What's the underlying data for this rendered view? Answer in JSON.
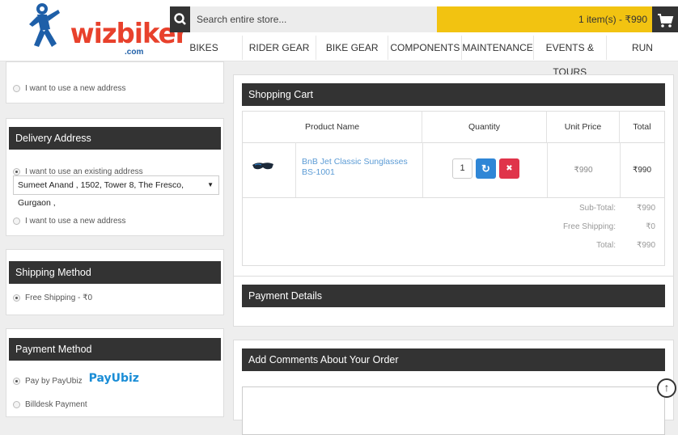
{
  "header": {
    "logo_text": "wizbiker",
    "logo_domain": ".com",
    "search_placeholder": "Search entire store...",
    "cart_label": "1 item(s) - ₹990",
    "nav": [
      "BIKES",
      "RIDER GEAR",
      "BIKE GEAR",
      "COMPONENTS",
      "MAINTENANCE",
      "EVENTS & TOURS",
      "RUN"
    ]
  },
  "payment_address": {
    "new_address_label": "I want to use a new address"
  },
  "delivery_address": {
    "title": "Delivery Address",
    "existing_label": "I want to use an existing address",
    "selected_address": "Sumeet Anand , 1502, Tower 8, The Fresco, Gurgaon ,",
    "new_address_label": "I want to use a new address"
  },
  "shipping_method": {
    "title": "Shipping Method",
    "option": "Free Shipping - ₹0"
  },
  "payment_method": {
    "title": "Payment Method",
    "option_payubiz": "Pay by PayUbiz",
    "payubiz_logo": "PayUbiz",
    "option_billdesk": "Billdesk Payment"
  },
  "cart": {
    "title": "Shopping Cart",
    "columns": [
      "Product Name",
      "Quantity",
      "Unit Price",
      "Total"
    ],
    "item": {
      "name": "BnB Jet Classic Sunglasses BS-1001",
      "quantity": "1",
      "unit_price": "₹990",
      "total": "₹990"
    },
    "totals": [
      {
        "label": "Sub-Total:",
        "value": "₹990"
      },
      {
        "label": "Free Shipping:",
        "value": "₹0"
      },
      {
        "label": "Total:",
        "value": "₹990"
      }
    ]
  },
  "payment_details": {
    "title": "Payment Details"
  },
  "comments": {
    "title": "Add Comments About Your Order"
  },
  "colors": {
    "accent": "#f2c311",
    "dark": "#333333",
    "brand_red": "#e8412c",
    "link": "#5b9bd5"
  }
}
